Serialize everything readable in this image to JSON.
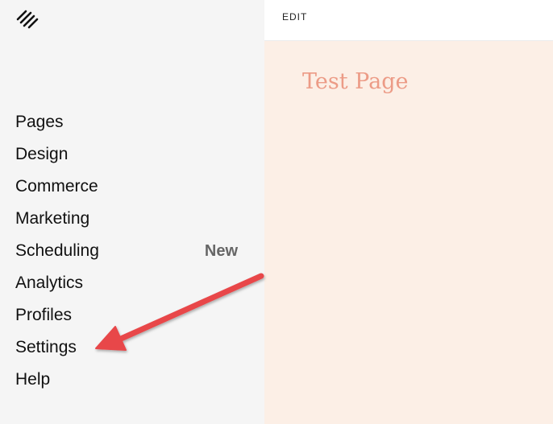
{
  "brand": {
    "logo_icon": "squarespace-logo-icon"
  },
  "sidebar": {
    "items": [
      {
        "label": "Pages",
        "badge": ""
      },
      {
        "label": "Design",
        "badge": ""
      },
      {
        "label": "Commerce",
        "badge": ""
      },
      {
        "label": "Marketing",
        "badge": ""
      },
      {
        "label": "Scheduling",
        "badge": "New"
      },
      {
        "label": "Analytics",
        "badge": ""
      },
      {
        "label": "Profiles",
        "badge": ""
      },
      {
        "label": "Settings",
        "badge": ""
      },
      {
        "label": "Help",
        "badge": ""
      }
    ]
  },
  "preview": {
    "edit_label": "EDIT",
    "page_title": "Test Page"
  },
  "annotation": {
    "arrow_color": "#e8474a",
    "arrow_target": "Settings"
  },
  "colors": {
    "sidebar_bg": "#f5f5f5",
    "preview_bg": "#fcefe6",
    "title_color": "#ec9b86"
  }
}
